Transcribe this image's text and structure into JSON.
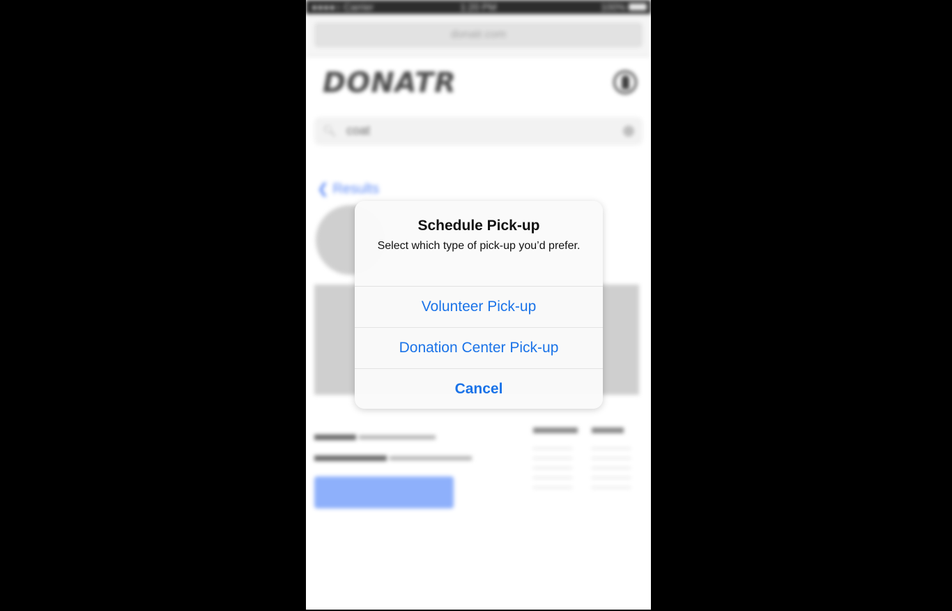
{
  "statusbar": {
    "carrier": "●●●●○ Carrier",
    "time": "1:20 PM",
    "battery": "100%"
  },
  "browser": {
    "url": "donatr.com"
  },
  "app": {
    "logo": "DONATR",
    "search_value": "coat",
    "back_label": "Results"
  },
  "alert": {
    "title": "Schedule Pick-up",
    "message": "Select which type of pick-up you’d prefer.",
    "actions": [
      {
        "label": "Volunteer Pick-up"
      },
      {
        "label": "Donation Center Pick-up"
      },
      {
        "label": "Cancel"
      }
    ]
  },
  "colors": {
    "action": "#1a73e8",
    "link": "#4a7cf7"
  }
}
